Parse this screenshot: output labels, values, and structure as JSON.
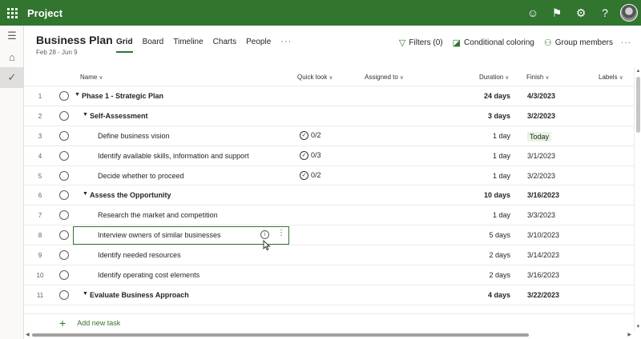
{
  "app": {
    "title": "Project"
  },
  "plan": {
    "title": "Business Plan",
    "dates": "Feb 28 - Jun 9"
  },
  "tabs": [
    {
      "label": "Grid",
      "active": true
    },
    {
      "label": "Board",
      "active": false
    },
    {
      "label": "Timeline",
      "active": false
    },
    {
      "label": "Charts",
      "active": false
    },
    {
      "label": "People",
      "active": false
    }
  ],
  "tab_more": "···",
  "actions": {
    "filters": "Filters (0)",
    "conditional": "Conditional coloring",
    "group": "Group members",
    "more": "···"
  },
  "columns": {
    "name": "Name",
    "quick_look": "Quick look",
    "assigned": "Assigned to",
    "duration": "Duration",
    "finish": "Finish",
    "labels": "Labels"
  },
  "rows": [
    {
      "num": "1",
      "level": 0,
      "summary": true,
      "name": "Phase 1 - Strategic Plan",
      "quick": "",
      "duration": "24 days",
      "finish": "4/3/2023"
    },
    {
      "num": "2",
      "level": 1,
      "summary": true,
      "name": "Self-Assessment",
      "quick": "",
      "duration": "3 days",
      "finish": "3/2/2023"
    },
    {
      "num": "3",
      "level": 2,
      "summary": false,
      "name": "Define business vision",
      "quick": "0/2",
      "duration": "1 day",
      "finish": "Today",
      "today": true
    },
    {
      "num": "4",
      "level": 2,
      "summary": false,
      "name": "Identify available skills, information and support",
      "quick": "0/3",
      "duration": "1 day",
      "finish": "3/1/2023"
    },
    {
      "num": "5",
      "level": 2,
      "summary": false,
      "name": "Decide whether to proceed",
      "quick": "0/2",
      "duration": "1 day",
      "finish": "3/2/2023"
    },
    {
      "num": "6",
      "level": 1,
      "summary": true,
      "name": "Assess the Opportunity",
      "quick": "",
      "duration": "10 days",
      "finish": "3/16/2023"
    },
    {
      "num": "7",
      "level": 2,
      "summary": false,
      "name": "Research the market and competition",
      "quick": "",
      "duration": "1 day",
      "finish": "3/3/2023"
    },
    {
      "num": "8",
      "level": 2,
      "summary": false,
      "name": "Interview owners of similar businesses",
      "quick": "",
      "duration": "5 days",
      "finish": "3/10/2023",
      "selected": true
    },
    {
      "num": "9",
      "level": 2,
      "summary": false,
      "name": "Identify needed resources",
      "quick": "",
      "duration": "2 days",
      "finish": "3/14/2023"
    },
    {
      "num": "10",
      "level": 2,
      "summary": false,
      "name": "Identify operating cost elements",
      "quick": "",
      "duration": "2 days",
      "finish": "3/16/2023"
    },
    {
      "num": "11",
      "level": 1,
      "summary": true,
      "name": "Evaluate Business Approach",
      "quick": "",
      "duration": "4 days",
      "finish": "3/22/2023"
    }
  ],
  "add_task": "Add new task",
  "colors": {
    "brand": "#31752f",
    "today_bg": "#e8f3e1"
  }
}
